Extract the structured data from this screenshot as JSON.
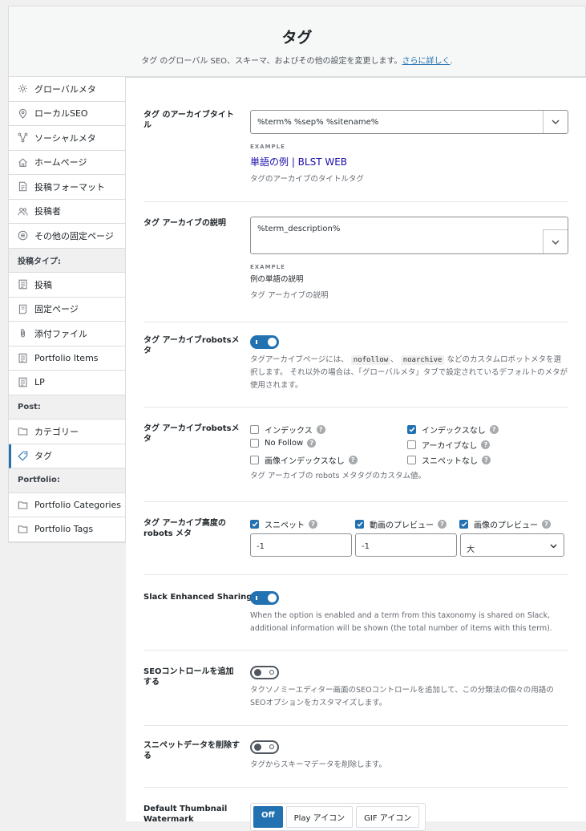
{
  "header": {
    "title": "タグ",
    "subtitle": "タグ のグローバル SEO、スキーマ、およびその他の設定を変更します。",
    "link": "さらに詳しく",
    "period": "."
  },
  "sidebar": {
    "group1": [
      {
        "label": "グローバルメタ",
        "icon": "gear-icon"
      },
      {
        "label": "ローカルSEO",
        "icon": "location-pin-icon"
      },
      {
        "label": "ソーシャルメタ",
        "icon": "share-icon"
      },
      {
        "label": "ホームページ",
        "icon": "home-icon"
      },
      {
        "label": "投稿フォーマット",
        "icon": "document-icon"
      },
      {
        "label": "投稿者",
        "icon": "users-icon"
      },
      {
        "label": "その他の固定ページ",
        "icon": "list-circle-icon"
      }
    ],
    "head_post_types": "投稿タイプ:",
    "group2": [
      {
        "label": "投稿",
        "icon": "post-icon"
      },
      {
        "label": "固定ページ",
        "icon": "page-icon"
      },
      {
        "label": "添付ファイル",
        "icon": "paperclip-icon"
      },
      {
        "label": "Portfolio Items",
        "icon": "post-icon"
      },
      {
        "label": "LP",
        "icon": "post-icon"
      }
    ],
    "head_post": "Post:",
    "group3": [
      {
        "label": "カテゴリー",
        "icon": "folder-icon"
      },
      {
        "label": "タグ",
        "icon": "tag-icon"
      }
    ],
    "head_portfolio": "Portfolio:",
    "group4": [
      {
        "label": "Portfolio Categories",
        "icon": "folder-icon"
      },
      {
        "label": "Portfolio Tags",
        "icon": "folder-icon"
      }
    ]
  },
  "archive_title": {
    "label": "タグ のアーカイブタイトル",
    "value": "%term% %sep% %sitename%",
    "example_label": "EXAMPLE",
    "example": "単語の例 | BLST WEB",
    "desc": "タグのアーカイブのタイトルタグ"
  },
  "archive_desc": {
    "label": "タグ アーカイブの説明",
    "value": "%term_description%",
    "example_label": "EXAMPLE",
    "example": "例の単語の説明",
    "desc": "タグ アーカイブの説明"
  },
  "robots_default": {
    "label": "タグ アーカイブrobotsメタ",
    "desc1": "タグアーカイブページには、",
    "code1": "nofollow",
    "sep": "、",
    "code2": "noarchive",
    "desc2": "などのカスタムロボットメタを選択します。 それ以外の場合は、「グローバルメタ」タブで設定されているデフォルトのメタが使用されます。"
  },
  "robots_custom": {
    "label": "タグ アーカイブrobotsメタ",
    "opts": [
      "インデックス",
      "No Follow",
      "画像インデックスなし",
      "インデックスなし",
      "アーカイブなし",
      "スニペットなし"
    ],
    "desc": "タグ アーカイブの robots メタタグのカスタム値。"
  },
  "robots_adv": {
    "label": "タグ アーカイブ高度の robots メタ",
    "snippet": "スニペット",
    "video": "動画のプレビュー",
    "image": "画像のプレビュー",
    "snippet_val": "-1",
    "video_val": "-1",
    "image_val": "大"
  },
  "slack": {
    "label": "Slack Enhanced Sharing",
    "desc": "When the option is enabled and a term from this taxonomy is shared on Slack, additional information will be shown (the total number of items with this term)."
  },
  "seo_ctl": {
    "label": "SEOコントロールを追加する",
    "desc": "タクソノミーエディター画面のSEOコントロールを追加して、この分類法の個々の用語のSEOオプションをカスタマイズします。"
  },
  "snippet_remove": {
    "label": "スニペットデータを削除する",
    "desc": "タグからスキーマデータを削除します。"
  },
  "thumb": {
    "label": "Default Thumbnail Watermark",
    "off": "Off",
    "play": "Play アイコン",
    "gif": "GIF アイコン"
  },
  "help": "?"
}
